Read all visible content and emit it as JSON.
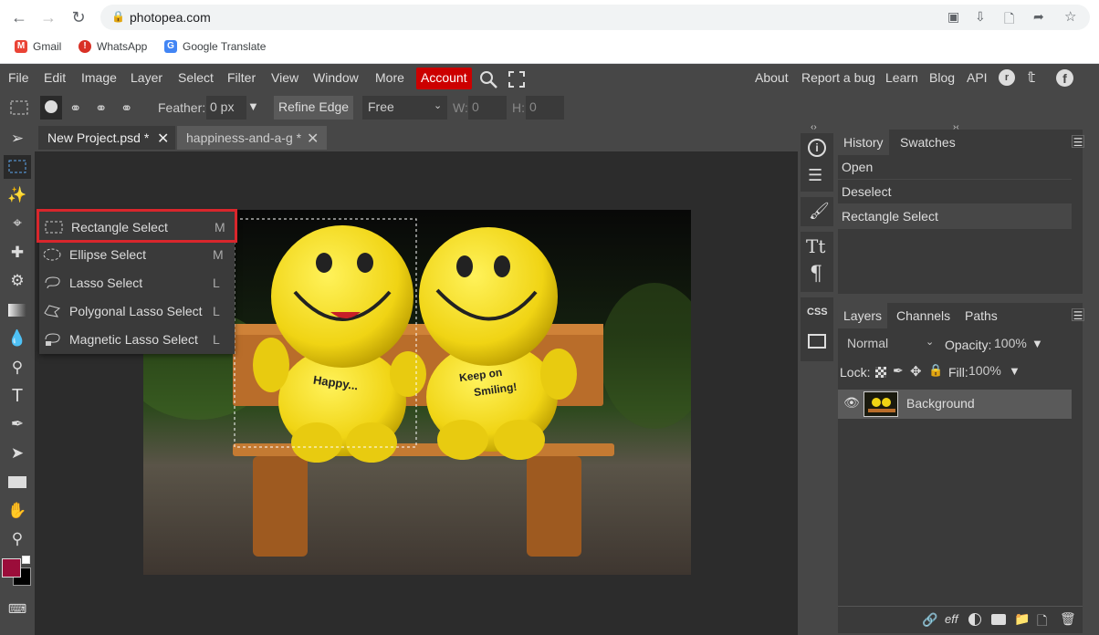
{
  "browser": {
    "url": "photopea.com",
    "bookmarks": [
      "Gmail",
      "WhatsApp",
      "Google Translate"
    ]
  },
  "menubar": {
    "items": [
      "File",
      "Edit",
      "Image",
      "Layer",
      "Select",
      "Filter",
      "View",
      "Window",
      "More"
    ],
    "account": "Account",
    "right_links": [
      "About",
      "Report a bug",
      "Learn",
      "Blog",
      "API"
    ]
  },
  "options": {
    "feather_label": "Feather:",
    "feather_value": "0 px",
    "refine_edge": "Refine Edge",
    "style_value": "Free",
    "w_label": "W:",
    "w_value": "0",
    "h_label": "H:",
    "h_value": "0"
  },
  "tabs": [
    {
      "label": "New Project.psd *",
      "active": true
    },
    {
      "label": "happiness-and-a-g *",
      "active": false
    }
  ],
  "flyout": [
    {
      "label": "Rectangle Select",
      "key": "M",
      "icon": "rect-select-icon"
    },
    {
      "label": "Ellipse Select",
      "key": "M",
      "icon": "ellipse-select-icon"
    },
    {
      "label": "Lasso Select",
      "key": "L",
      "icon": "lasso-icon"
    },
    {
      "label": "Polygonal Lasso Select",
      "key": "L",
      "icon": "polygonal-lasso-icon"
    },
    {
      "label": "Magnetic Lasso Select",
      "key": "L",
      "icon": "magnetic-lasso-icon"
    }
  ],
  "canvas_text": {
    "left_toy": "Happy...",
    "right_toy_1": "Keep on",
    "right_toy_2": "Smiling!"
  },
  "history": {
    "tabs": [
      "History",
      "Swatches"
    ],
    "items": [
      "Open",
      "Deselect",
      "Rectangle Select"
    ]
  },
  "layers": {
    "tabs": [
      "Layers",
      "Channels",
      "Paths"
    ],
    "blend_mode": "Normal",
    "opacity_label": "Opacity:",
    "opacity_value": "100%",
    "lock_label": "Lock:",
    "fill_label": "Fill:",
    "fill_value": "100%",
    "items": [
      {
        "name": "Background"
      }
    ]
  },
  "side_strip": {
    "css_label": "CSS",
    "text_label": "Tt"
  },
  "colors": {
    "foreground": "#9b0d3a",
    "background": "#000000",
    "accent": "#cc0000",
    "highlight": "#d9262c"
  }
}
